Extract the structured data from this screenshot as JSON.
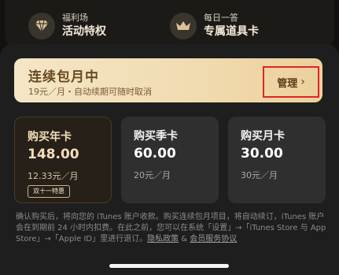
{
  "perks": [
    {
      "small": "福利场",
      "big": "活动特权",
      "icon": "diamond-icon"
    },
    {
      "small": "每日一答",
      "big": "专属道具卡",
      "icon": "crown-icon"
    }
  ],
  "banner": {
    "title": "连续包月中",
    "subtitle": "19元／月・自动续期可随时取消",
    "manage_label": "管理",
    "manage_chevron": "›"
  },
  "plans": [
    {
      "name": "购买年卡",
      "price": "148.00",
      "unit": "12.33元／月",
      "badge": "双十一特惠",
      "selected": true
    },
    {
      "name": "购买季卡",
      "price": "60.00",
      "unit": "20元／月"
    },
    {
      "name": "购买月卡",
      "price": "30.00",
      "unit": "30元／月"
    }
  ],
  "terms": {
    "text": "确认购买后，将向您的 iTunes 账户收款。购买连续包月项目，将自动续订，iTunes 账户会在到期前 24 小时内扣费。在此之前，您可以在系统「设置」→「iTunes Store 与 App Store」→「Apple ID」里进行退订。",
    "privacy_link": "隐私政策",
    "and": " & ",
    "service_link": "会员服务协议"
  },
  "colors": {
    "accent_gold": "#f1dcb2",
    "highlight_red": "#e02424"
  }
}
